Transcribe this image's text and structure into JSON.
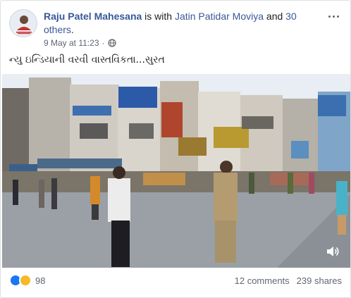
{
  "post": {
    "author": "Raju Patel Mahesana",
    "with_text": " is with ",
    "tagged_person": "Jatin Patidar Moviya",
    "and_text": " and ",
    "others_text": "30 others",
    "others_end": ".",
    "timestamp": "9 May at 11:23",
    "separator": " · ",
    "privacy_icon": "globe-icon",
    "body": "ન્યુ ઇન્ડિયાની વરવી વાસ્તવિકતા...સુરત"
  },
  "video": {
    "volume_icon": "speaker-icon"
  },
  "footer": {
    "reaction_icons": [
      "like-icon",
      "sad-icon"
    ],
    "reaction_count": "98",
    "comments": "12 comments",
    "shares": "239 shares"
  },
  "colors": {
    "link": "#385898",
    "like": "#1877f2",
    "sad": "#f7b928",
    "meta": "#606770"
  }
}
